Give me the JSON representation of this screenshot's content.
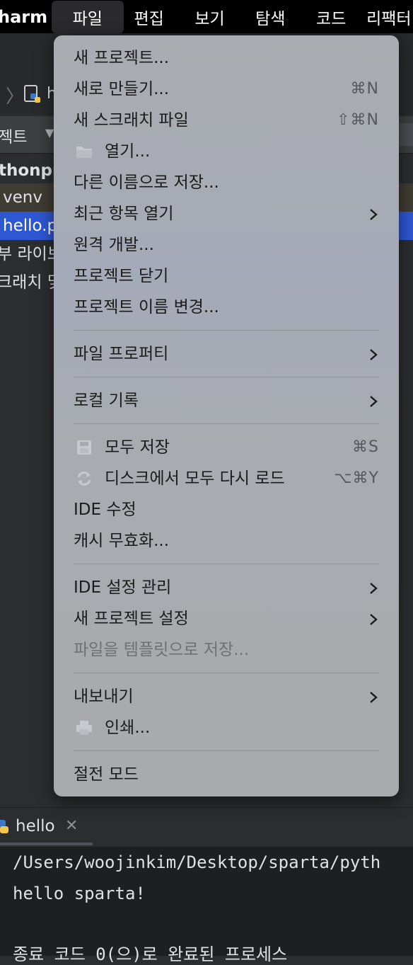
{
  "menubar": {
    "app_name": "harm",
    "menus": [
      "파일",
      "편집",
      "보기",
      "탐색",
      "코드",
      "리팩터"
    ]
  },
  "breadcrumb": {
    "file_label": "h"
  },
  "project_panel": {
    "header_label": "젝트",
    "tree": {
      "root": "thonpr",
      "venv": "venv",
      "selected_file": "hello.p",
      "external_libs": "부 라이브",
      "scratches": "크래치 및"
    }
  },
  "file_menu": {
    "new_project": "새 프로젝트...",
    "new": "새로 만들기...",
    "new_shortcut": "⌘N",
    "new_scratch": "새 스크래치 파일",
    "new_scratch_shortcut": "⇧⌘N",
    "open": "열기...",
    "save_as": "다른 이름으로 저장...",
    "open_recent": "최근 항목 열기",
    "remote_dev": "원격 개발...",
    "close_project": "프로젝트 닫기",
    "rename_project": "프로젝트 이름 변경...",
    "file_properties": "파일 프로퍼티",
    "local_history": "로컬 기록",
    "save_all": "모두 저장",
    "save_all_shortcut": "⌘S",
    "reload_all": "디스크에서 모두 다시 로드",
    "reload_all_shortcut": "⌥⌘Y",
    "repair_ide": "IDE 수정",
    "invalidate_caches": "캐시 무효화...",
    "manage_ide_settings": "IDE 설정 관리",
    "new_project_setup": "새 프로젝트 설정",
    "save_as_template": "파일을 템플릿으로 저장...",
    "export": "내보내기",
    "print": "인쇄...",
    "power_save_mode": "절전 모드"
  },
  "run_panel": {
    "tab_label": "hello",
    "close_glyph": "✕",
    "console_lines": [
      "/Users/woojinkim/Desktop/sparta/pyth",
      "hello sparta!",
      "종료 코드 0(으)로 완료된 프로세스"
    ]
  },
  "colors": {
    "menu_background": "#a8abaf",
    "selected_row": "#2e57d3",
    "menubar": "#000000"
  }
}
